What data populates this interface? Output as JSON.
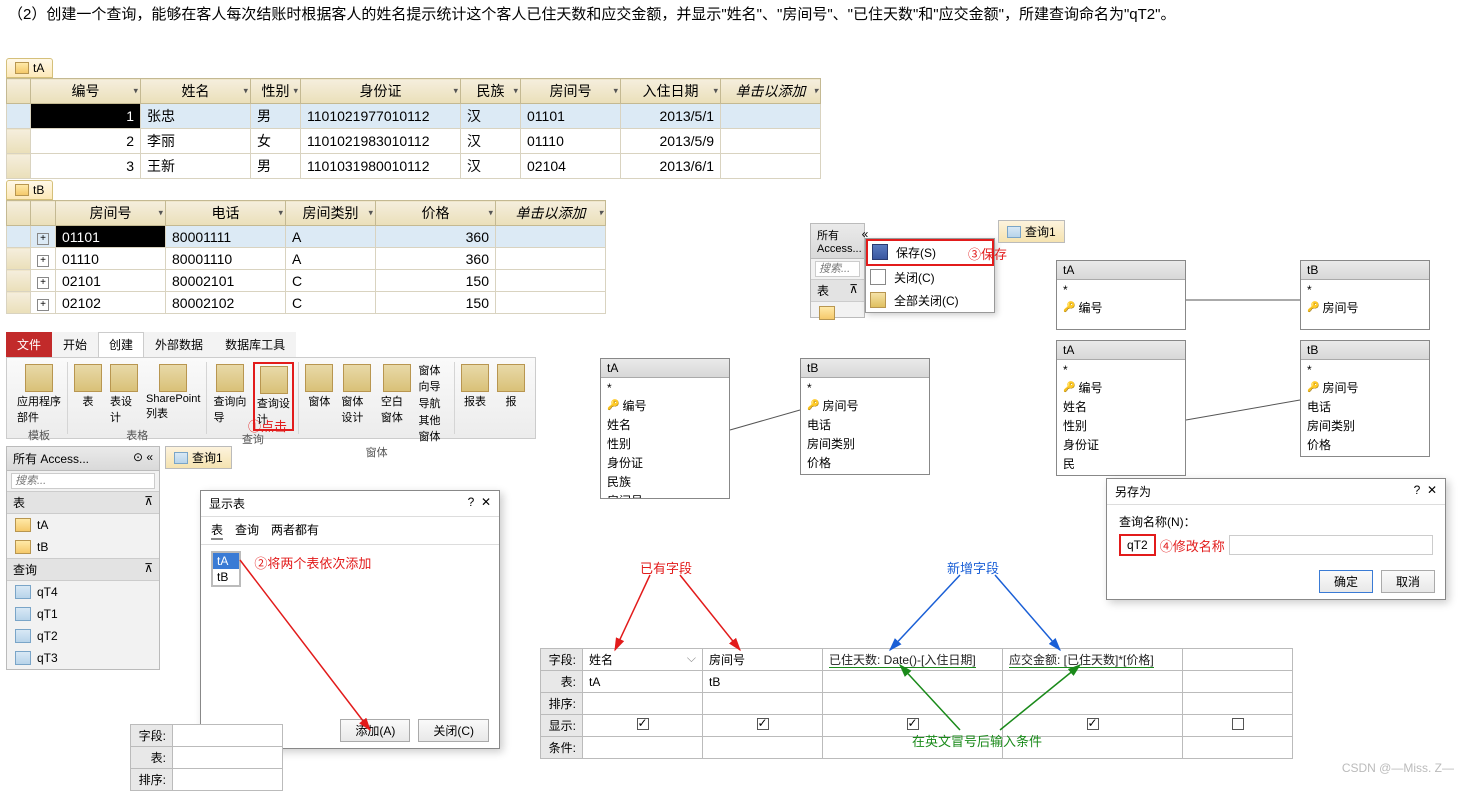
{
  "question": "（2）创建一个查询，能够在客人每次结账时根据客人的姓名提示统计这个客人已住天数和应交金额，并显示\"姓名\"、\"房间号\"、\"已住天数\"和\"应交金额\"，所建查询命名为\"qT2\"。",
  "tA": {
    "tab": "tA",
    "headers": [
      "编号",
      "姓名",
      "性别",
      "身份证",
      "民族",
      "房间号",
      "入住日期",
      "单击以添加"
    ],
    "rows": [
      [
        "1",
        "张忠",
        "男",
        "1101021977010112",
        "汉",
        "01101",
        "2013/5/1"
      ],
      [
        "2",
        "李丽",
        "女",
        "1101021983010112",
        "汉",
        "01110",
        "2013/5/9"
      ],
      [
        "3",
        "王新",
        "男",
        "1101031980010112",
        "汉",
        "02104",
        "2013/6/1"
      ]
    ]
  },
  "tB": {
    "tab": "tB",
    "headers": [
      "房间号",
      "电话",
      "房间类别",
      "价格",
      "单击以添加"
    ],
    "rows": [
      [
        "01101",
        "80001111",
        "A",
        "360"
      ],
      [
        "01110",
        "80001110",
        "A",
        "360"
      ],
      [
        "02101",
        "80002101",
        "C",
        "150"
      ],
      [
        "02102",
        "80002102",
        "C",
        "150"
      ]
    ]
  },
  "ribbon": {
    "tabs": [
      "文件",
      "开始",
      "创建",
      "外部数据",
      "数据库工具"
    ],
    "g_template": "模板",
    "g_tables": "表格",
    "g_query": "查询",
    "g_form": "窗体",
    "i_appparts": "应用程序\n部件",
    "i_table": "表",
    "i_tabledesign": "表设计",
    "i_sharepoint": "SharePoint\n列表",
    "i_qwiz": "查询向导",
    "i_qdes": "查询设计",
    "i_form": "窗体",
    "i_formdes": "窗体设计",
    "i_blankform": "空白窗体",
    "i_formwiz": "窗体向导",
    "i_nav": "导航",
    "i_otherform": "其他窗体",
    "i_report": "报表",
    "i_rep2": "报"
  },
  "anno": {
    "click": "①点击",
    "addtables": "②将两个表依次添加",
    "save": "③保存",
    "rename": "④修改名称",
    "existing": "已有字段",
    "newfield": "新增字段",
    "greenhint": "在英文冒号后输入条件"
  },
  "nav1": {
    "title": "所有 Access...",
    "search": "搜索...",
    "cat_table": "表",
    "cat_query": "查询",
    "tables": [
      "tA",
      "tB"
    ],
    "queries": [
      "qT4",
      "qT1",
      "qT2",
      "qT3"
    ]
  },
  "q1tab": "查询1",
  "showtable": {
    "title": "显示表",
    "tabs": [
      "表",
      "查询",
      "两者都有"
    ],
    "items": [
      "tA",
      "tB"
    ],
    "btn_add": "添加(A)",
    "btn_close": "关闭(C)"
  },
  "menu": {
    "save": "保存(S)",
    "close": "关闭(C)",
    "closeall": "全部关闭(C)"
  },
  "nav2": {
    "title": "所有 Access...",
    "search": "搜索...",
    "cat_table": "表"
  },
  "fields_tA": {
    "title": "tA",
    "star": "*",
    "items": [
      "编号",
      "姓名",
      "性别",
      "身份证",
      "民族",
      "房间号"
    ]
  },
  "fields_tB": {
    "title": "tB",
    "star": "*",
    "items": [
      "房间号",
      "电话",
      "房间类别",
      "价格"
    ]
  },
  "fields_tA2": {
    "title": "tA",
    "star": "*",
    "items": [
      "编号",
      "姓名",
      "性别",
      "身份证",
      "民"
    ]
  },
  "fields_tB2": {
    "title": "tB",
    "star": "*",
    "items": [
      "房间号",
      "电话",
      "房间类别",
      "价格"
    ]
  },
  "saveas": {
    "title": "另存为",
    "label": "查询名称(N)：",
    "value": "qT2",
    "ok": "确定",
    "cancel": "取消"
  },
  "grid": {
    "rowlabels": [
      "字段:",
      "表:",
      "排序:",
      "显示:",
      "条件:"
    ],
    "cols": [
      {
        "field": "姓名",
        "table": "tA",
        "show": true
      },
      {
        "field": "房间号",
        "table": "tB",
        "show": true
      },
      {
        "field": "已住天数: Date()-[入住日期]",
        "table": "",
        "show": true,
        "expr": true
      },
      {
        "field": "应交金额: [已住天数]*[价格]",
        "table": "",
        "show": true,
        "expr": true
      }
    ]
  },
  "smallgrid": {
    "rowlabels": [
      "字段:",
      "表:",
      "排序:"
    ]
  },
  "watermark": "CSDN @—Miss. Z—"
}
